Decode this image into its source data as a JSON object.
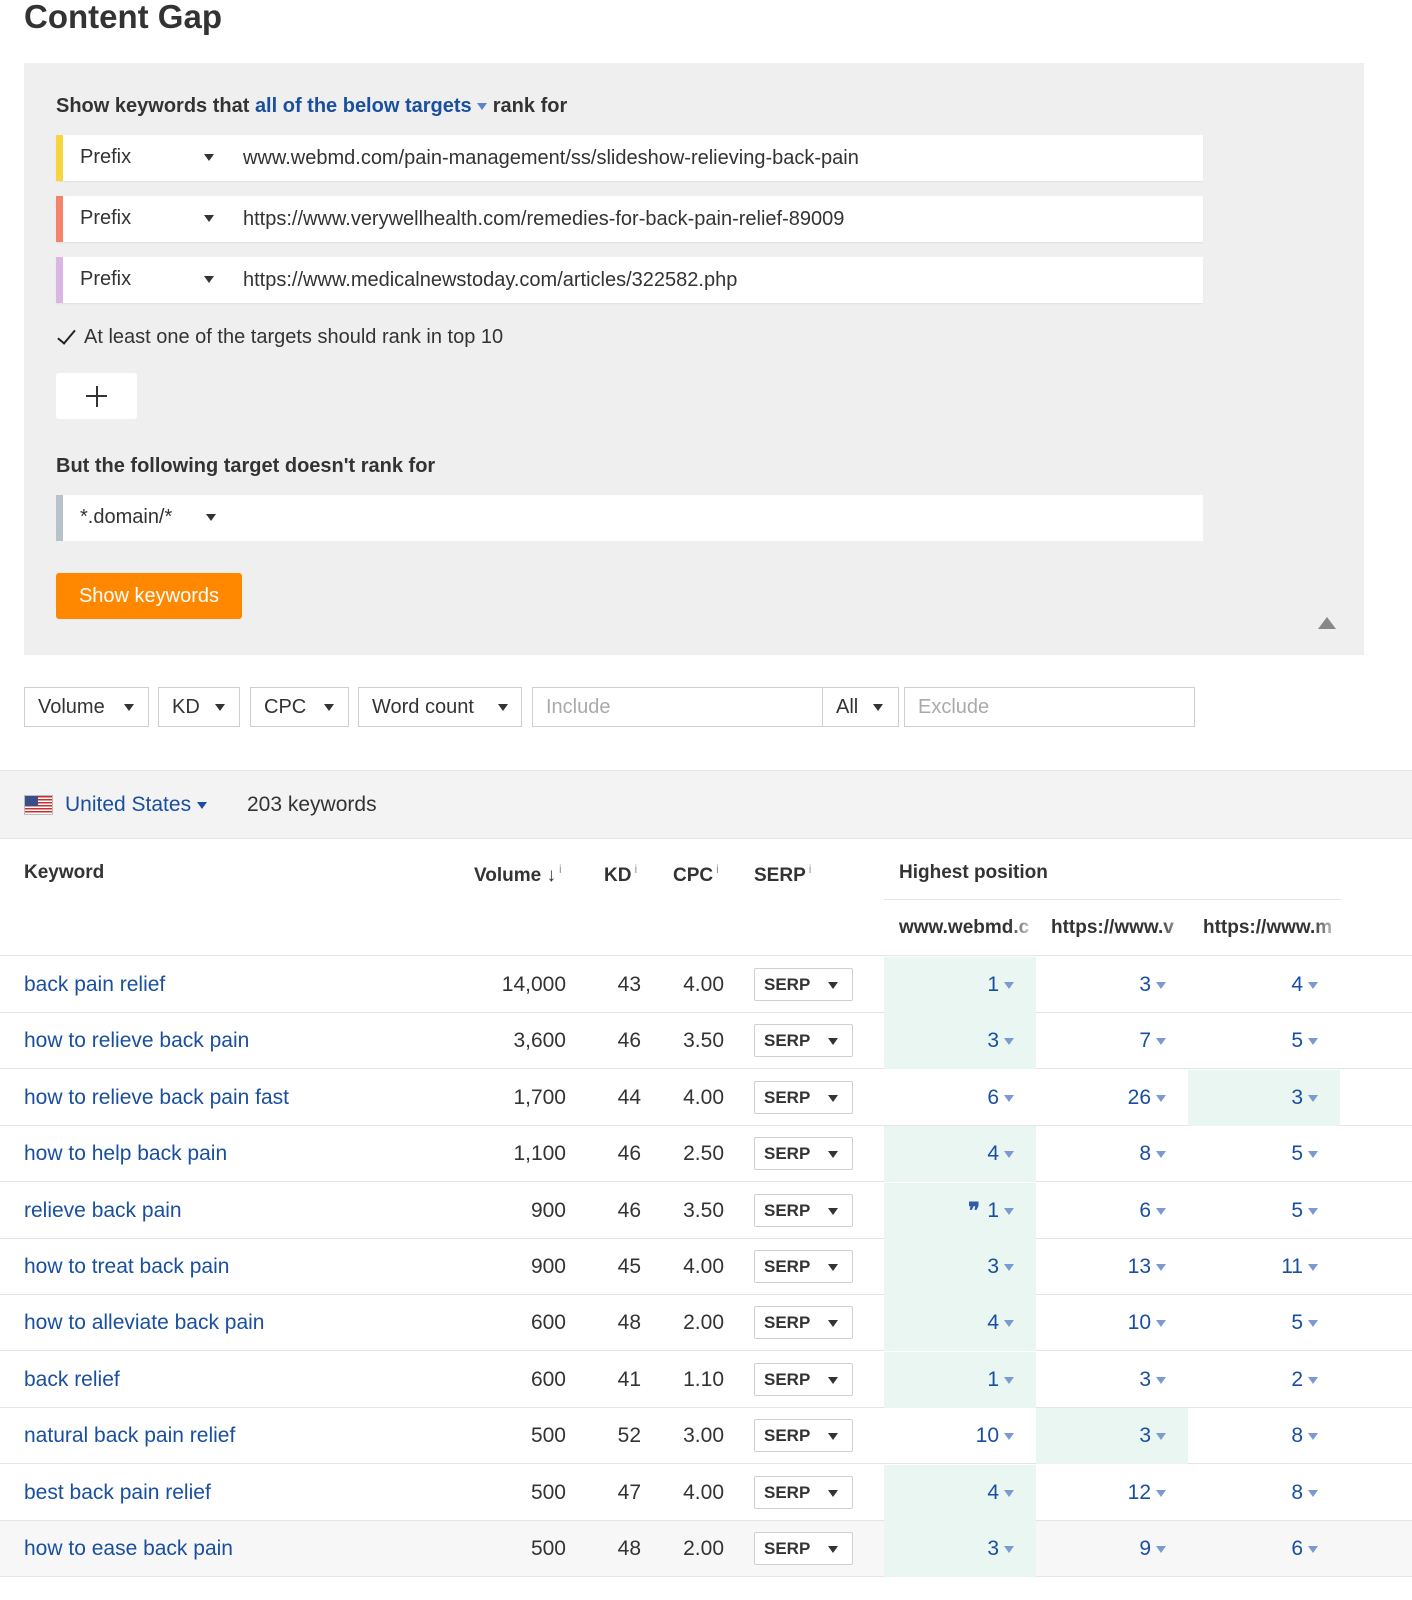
{
  "page_title": "Content Gap",
  "config": {
    "heading_prefix": "Show keywords that",
    "heading_mode": "all of the below targets",
    "heading_suffix": "rank for",
    "targets": [
      {
        "mode": "Prefix",
        "url": "www.webmd.com/pain-management/ss/slideshow-relieving-back-pain",
        "color": "#f7d63b"
      },
      {
        "mode": "Prefix",
        "url": "https://www.verywellhealth.com/remedies-for-back-pain-relief-89009",
        "color": "#f4836a"
      },
      {
        "mode": "Prefix",
        "url": "https://www.medicalnewstoday.com/articles/322582.php",
        "color": "#dab6e4"
      }
    ],
    "top10_checkbox_label": "At least one of the targets should rank in top 10",
    "top10_checked": true,
    "exclude_heading": "But the following target doesn't rank for",
    "exclude_mode": "*.domain/*",
    "exclude_color": "#b7c3cb",
    "show_button": "Show keywords",
    "accent_color": "#ff8800"
  },
  "filters": {
    "volume": "Volume",
    "kd": "KD",
    "cpc": "CPC",
    "word_count": "Word count",
    "include_placeholder": "Include",
    "match_mode": "All",
    "exclude_placeholder": "Exclude"
  },
  "results": {
    "country": "United States",
    "count": "203 keywords"
  },
  "columns": {
    "keyword": "Keyword",
    "volume": "Volume",
    "kd": "KD",
    "cpc": "CPC",
    "serp": "SERP",
    "info": "i",
    "highest_position": "Highest position",
    "sites": [
      "www.webmd.c",
      "https://www.v",
      "https://www.m"
    ]
  },
  "serp_button_label": "SERP",
  "rows": [
    {
      "keyword": "back pain relief",
      "volume": "14,000",
      "kd": "43",
      "cpc": "4.00",
      "positions": [
        "1",
        "3",
        "4"
      ],
      "best": 0,
      "snippet": false
    },
    {
      "keyword": "how to relieve back pain",
      "volume": "3,600",
      "kd": "46",
      "cpc": "3.50",
      "positions": [
        "3",
        "7",
        "5"
      ],
      "best": 0,
      "snippet": false
    },
    {
      "keyword": "how to relieve back pain fast",
      "volume": "1,700",
      "kd": "44",
      "cpc": "4.00",
      "positions": [
        "6",
        "26",
        "3"
      ],
      "best": 2,
      "snippet": false
    },
    {
      "keyword": "how to help back pain",
      "volume": "1,100",
      "kd": "46",
      "cpc": "2.50",
      "positions": [
        "4",
        "8",
        "5"
      ],
      "best": 0,
      "snippet": false
    },
    {
      "keyword": "relieve back pain",
      "volume": "900",
      "kd": "46",
      "cpc": "3.50",
      "positions": [
        "1",
        "6",
        "5"
      ],
      "best": 0,
      "snippet": true
    },
    {
      "keyword": "how to treat back pain",
      "volume": "900",
      "kd": "45",
      "cpc": "4.00",
      "positions": [
        "3",
        "13",
        "11"
      ],
      "best": 0,
      "snippet": false
    },
    {
      "keyword": "how to alleviate back pain",
      "volume": "600",
      "kd": "48",
      "cpc": "2.00",
      "positions": [
        "4",
        "10",
        "5"
      ],
      "best": 0,
      "snippet": false
    },
    {
      "keyword": "back relief",
      "volume": "600",
      "kd": "41",
      "cpc": "1.10",
      "positions": [
        "1",
        "3",
        "2"
      ],
      "best": 0,
      "snippet": false
    },
    {
      "keyword": "natural back pain relief",
      "volume": "500",
      "kd": "52",
      "cpc": "3.00",
      "positions": [
        "10",
        "3",
        "8"
      ],
      "best": 1,
      "snippet": false
    },
    {
      "keyword": "best back pain relief",
      "volume": "500",
      "kd": "47",
      "cpc": "4.00",
      "positions": [
        "4",
        "12",
        "8"
      ],
      "best": 0,
      "snippet": false
    },
    {
      "keyword": "how to ease back pain",
      "volume": "500",
      "kd": "48",
      "cpc": "2.00",
      "positions": [
        "3",
        "9",
        "6"
      ],
      "best": 0,
      "snippet": false
    }
  ]
}
